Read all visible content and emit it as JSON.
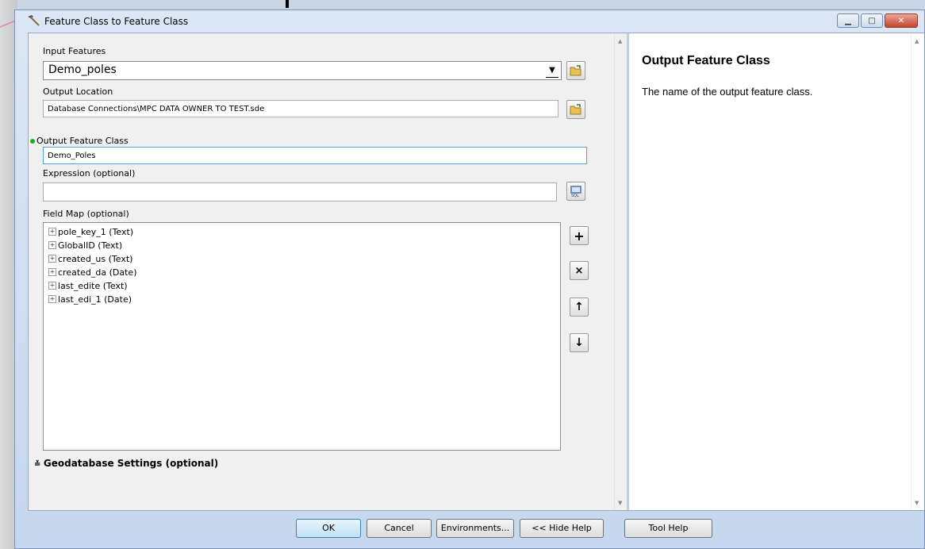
{
  "window": {
    "title": "Feature Class to Feature Class"
  },
  "form": {
    "input_features_label": "Input Features",
    "input_features_value": "Demo_poles",
    "output_location_label": "Output Location",
    "output_location_value": "Database Connections\\MPC DATA OWNER TO TEST.sde",
    "output_feature_class_label": "Output Feature Class",
    "output_feature_class_value": "Demo_Poles",
    "expression_label": "Expression (optional)",
    "expression_value": "",
    "field_map_label": "Field Map (optional)",
    "field_map_items": [
      "pole_key_1 (Text)",
      "GlobalID (Text)",
      "created_us (Text)",
      "created_da (Date)",
      "last_edite (Text)",
      "last_edi_1 (Date)"
    ],
    "geodatabase_settings_label": "Geodatabase Settings (optional)"
  },
  "help": {
    "title": "Output Feature Class",
    "text": "The name of the output feature class."
  },
  "buttons": {
    "ok": "OK",
    "cancel": "Cancel",
    "environments": "Environments...",
    "hide_help": "<< Hide Help",
    "tool_help": "Tool Help"
  },
  "colors": {
    "required_dot": "#19b219",
    "default_button": "#bfe0f6"
  }
}
